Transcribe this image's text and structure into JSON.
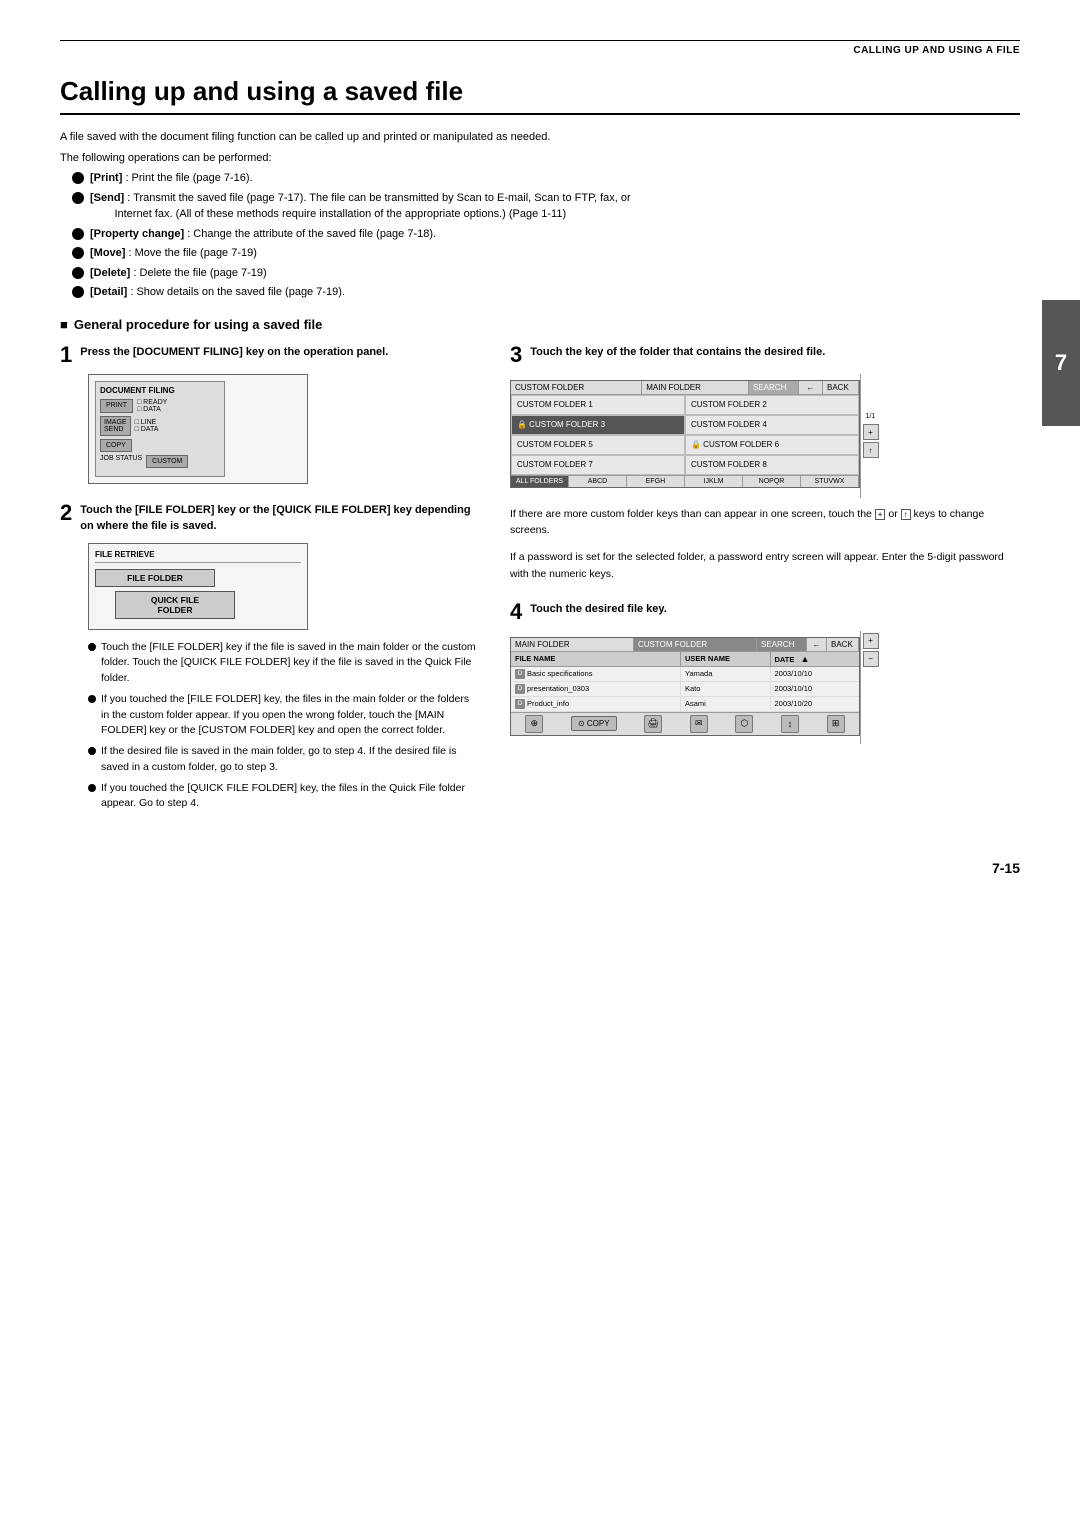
{
  "header": {
    "rule": true,
    "title": "CALLING UP AND USING A FILE"
  },
  "chapter": {
    "title": "Calling up and using a saved file"
  },
  "intro": {
    "line1": "A file saved with the document filing function can be called up and printed or manipulated as needed.",
    "line2": "The following operations can be performed:",
    "bullets": [
      {
        "label": "[Print]",
        "text": ": Print the file (page 7-16)."
      },
      {
        "label": "[Send]",
        "text": ": Transmit the saved file (page 7-17). The file can be transmitted by Scan to E-mail, Scan to FTP, fax, or Internet fax. (All of these methods require installation of the appropriate options.) (Page 1-11)"
      },
      {
        "label": "[Property change]",
        "text": ": Change the attribute of the saved file (page 7-18)."
      },
      {
        "label": "[Move]",
        "text": ": Move the file (page 7-19)"
      },
      {
        "label": "[Delete]",
        "text": ": Delete the file (page 7-19)"
      },
      {
        "label": "[Detail]",
        "text": ": Show details on the saved file (page 7-19)."
      }
    ]
  },
  "section": {
    "heading": "General procedure for using a saved file"
  },
  "steps": [
    {
      "number": "1",
      "title": "Press the [DOCUMENT FILING] key on the operation panel.",
      "panel": {
        "items": [
          "DOCUMENT FILING",
          "PRINT",
          "READY",
          "DATA",
          "IMAGE SEND",
          "LINE",
          "DATA",
          "COPY",
          "JOB STATUS",
          "CUSTOM"
        ]
      }
    },
    {
      "number": "2",
      "title": "Touch the [FILE FOLDER] key or the [QUICK FILE FOLDER] key depending on where the file is saved.",
      "panel": {
        "items": [
          "FILE RETRIEVE",
          "FILE FOLDER",
          "QUICK FILE FOLDER"
        ]
      },
      "bullets": [
        "Touch the [FILE FOLDER] key if the file is saved in the main folder or the custom folder. Touch the [QUICK FILE FOLDER] key if the file is saved in the Quick File folder.",
        "If you touched the [FILE FOLDER] key, the files in the main folder or the folders in the custom folder appear. If you open the wrong folder, touch the [MAIN FOLDER] key or the [CUSTOM FOLDER] key and open the correct folder.",
        "If the desired file is saved in the main folder, go to step 4. If the desired file is saved in a custom folder, go to step 3.",
        "If you touched the [QUICK FILE FOLDER] key, the files in the Quick File folder appear. Go to step 4."
      ]
    },
    {
      "number": "3",
      "title": "Touch the key of the folder that contains the desired file.",
      "folder_screen": {
        "header": [
          "CUSTOM FOLDER",
          "MAIN FOLDER",
          "SEARCH",
          "←",
          "BACK"
        ],
        "rows": [
          [
            "CUSTOM FOLDER 1",
            "CUSTOM FOLDER 2"
          ],
          [
            "🔒 CUSTOM FOLDER 3",
            "CUSTOM FOLDER 4"
          ],
          [
            "CUSTOM FOLDER 5",
            "🔒 CUSTOM FOLDER 6"
          ],
          [
            "CUSTOM FOLDER 7",
            "CUSTOM FOLDER 8"
          ]
        ],
        "pagination": "1/1",
        "tabs": [
          "ALL FOLDERS",
          "ABCD",
          "EFGH",
          "IJKLM",
          "NOPQR",
          "STUVWX"
        ]
      },
      "explain1": "If there are more custom folder keys than can appear in one screen, touch the [+] or [↑] keys to change screens.",
      "explain2": "If a password is set for the selected folder, a password entry screen will appear. Enter the 5-digit password with the numeric keys."
    },
    {
      "number": "4",
      "title": "Touch the desired file key.",
      "file_screen": {
        "header": [
          "MAIN FOLDER",
          "CUSTOM FOLDER",
          "SEARCH",
          "←",
          "BACK"
        ],
        "cols": [
          "FILE NAME",
          "USER NAME",
          "DATE"
        ],
        "rows": [
          {
            "icon": "doc",
            "name": "Basic specifications",
            "user": "Yamada",
            "date": "2003/10/10"
          },
          {
            "icon": "doc",
            "name": "presentation_0303",
            "user": "Kato",
            "date": "2003/10/10"
          },
          {
            "icon": "doc",
            "name": "Product_info",
            "user": "Asami",
            "date": "2003/10/20"
          }
        ],
        "toolbar_icons": [
          "⊕",
          "COPY",
          "🖨",
          "✉",
          "⬡",
          "↕",
          "⊞"
        ]
      }
    }
  ],
  "page_tab": "7",
  "page_number": "7-15"
}
